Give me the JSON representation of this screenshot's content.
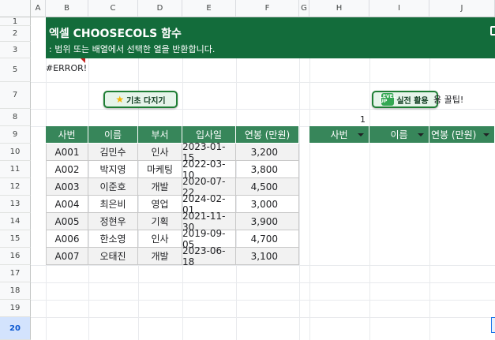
{
  "columns": [
    "A",
    "B",
    "C",
    "D",
    "E",
    "F",
    "G",
    "H",
    "I",
    "J"
  ],
  "rows": [
    "1",
    "2",
    "3",
    "5",
    "7",
    "8",
    "9",
    "10",
    "11",
    "12",
    "13",
    "14",
    "15",
    "16",
    "17",
    "18",
    "19",
    "20"
  ],
  "selected_row": "20",
  "banner": {
    "title": "엑셀 CHOOSECOLS 함수",
    "subtitle": ": 범위 또는 배열에서 선택한 열을 반환합니다."
  },
  "error_cell": "#ERROR!",
  "buttons": {
    "basics": "기초 다지기",
    "practice": "실전 활용",
    "level_badge": "LEVEL UP"
  },
  "tip_text": "용 꿀팁!",
  "result_index": "1",
  "table": {
    "headers": [
      "사번",
      "이름",
      "부서",
      "입사일",
      "연봉 (만원)"
    ],
    "rows": [
      [
        "A001",
        "김민수",
        "인사",
        "2023-01-15",
        "3,200"
      ],
      [
        "A002",
        "박지영",
        "마케팅",
        "2022-03-10",
        "3,800"
      ],
      [
        "A003",
        "이준호",
        "개발",
        "2020-07-22",
        "4,500"
      ],
      [
        "A004",
        "최은비",
        "영업",
        "2024-02-01",
        "3,000"
      ],
      [
        "A005",
        "정현우",
        "기획",
        "2021-11-30",
        "3,900"
      ],
      [
        "A006",
        "한소영",
        "인사",
        "2019-09-05",
        "4,700"
      ],
      [
        "A007",
        "오태진",
        "개발",
        "2023-06-18",
        "3,100"
      ]
    ]
  },
  "result_headers": [
    "사번",
    "이름",
    "연봉 (만원)"
  ],
  "colors": {
    "banner": "#136c3b",
    "header_fill": "#37865a",
    "button_fill": "#e6f4ea",
    "error_marker": "#c5221f"
  }
}
